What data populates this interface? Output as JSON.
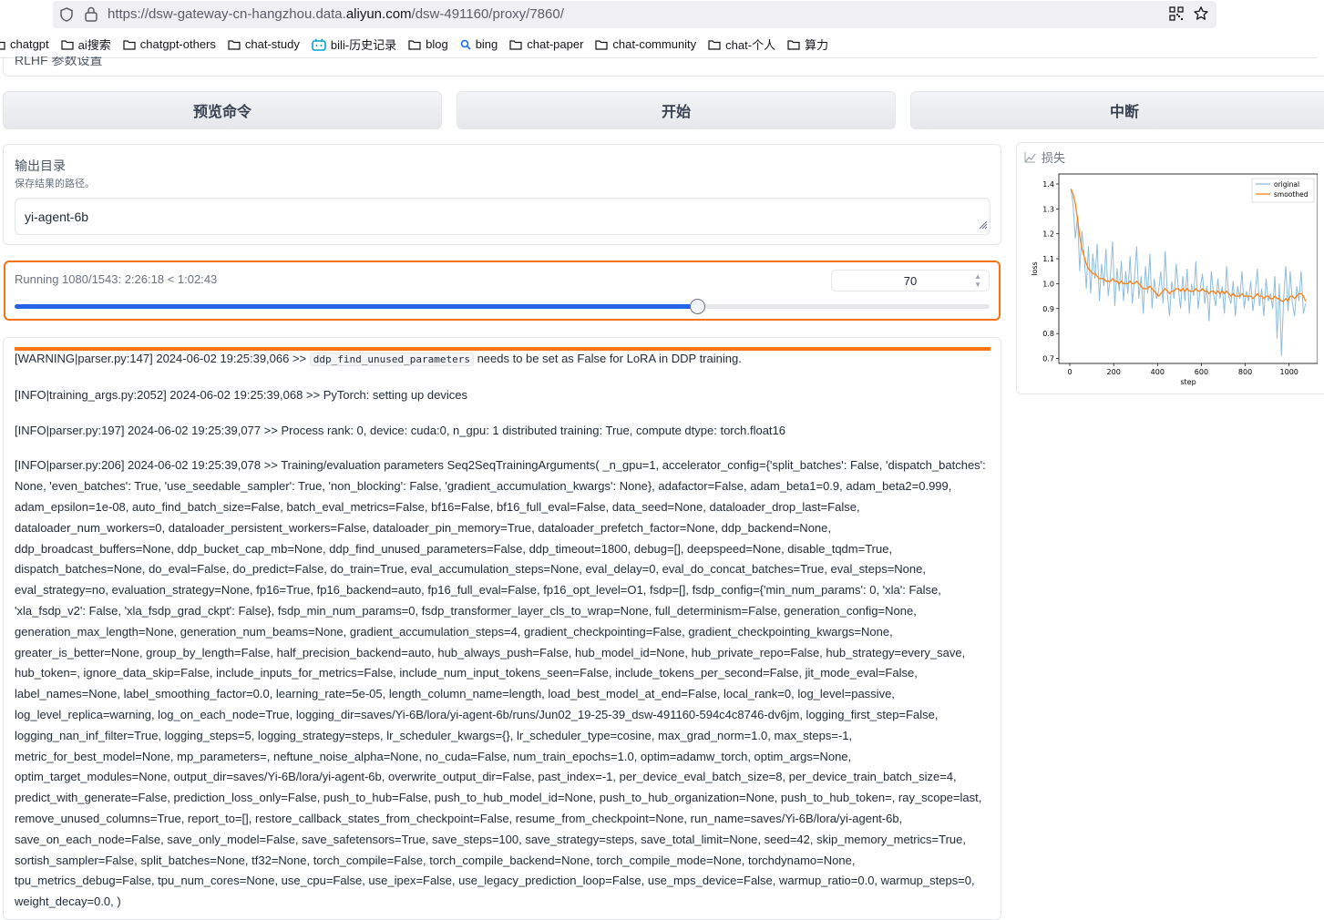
{
  "browser": {
    "url_prefix": "https://dsw-gateway-cn-hangzhou.data.",
    "url_domain": "aliyun.com",
    "url_suffix": "/dsw-491160/proxy/7860/",
    "bookmarks": [
      {
        "label": "chatgpt",
        "icon": "folder-icon"
      },
      {
        "label": "ai搜索",
        "icon": "folder-icon"
      },
      {
        "label": "chatgpt-others",
        "icon": "folder-icon"
      },
      {
        "label": "chat-study",
        "icon": "folder-icon"
      },
      {
        "label": "bili-历史记录",
        "icon": "bilibili-icon"
      },
      {
        "label": "blog",
        "icon": "folder-icon"
      },
      {
        "label": "bing",
        "icon": "search-icon"
      },
      {
        "label": "chat-paper",
        "icon": "folder-icon"
      },
      {
        "label": "chat-community",
        "icon": "folder-icon"
      },
      {
        "label": "chat-个人",
        "icon": "folder-icon"
      },
      {
        "label": "算力",
        "icon": "folder-icon"
      }
    ]
  },
  "app": {
    "rlhf_section_label": "RLHF 参数设置",
    "buttons": {
      "preview": "预览命令",
      "start": "开始",
      "abort": "中断"
    },
    "output_dir": {
      "label": "输出目录",
      "hint": "保存结果的路径。",
      "value": "yi-agent-6b"
    },
    "progress": {
      "label": "Running 1080/1543: 2:26:18 < 1:02:43",
      "number_value": "70",
      "fraction": 0.7
    },
    "log": {
      "line1_before": "[WARNING|parser.py:147] 2024-06-02 19:25:39,066 >> ",
      "line1_code": "ddp_find_unused_parameters",
      "line1_after": " needs to be set as False for LoRA in DDP training.",
      "line2": "[INFO|training_args.py:2052] 2024-06-02 19:25:39,068 >> PyTorch: setting up devices",
      "line3": "[INFO|parser.py:197] 2024-06-02 19:25:39,077 >> Process rank: 0, device: cuda:0, n_gpu: 1 distributed training: True, compute dtype: torch.float16",
      "line4": "[INFO|parser.py:206] 2024-06-02 19:25:39,078 >> Training/evaluation parameters Seq2SeqTrainingArguments( _n_gpu=1, accelerator_config={'split_batches': False, 'dispatch_batches': None, 'even_batches': True, 'use_seedable_sampler': True, 'non_blocking': False, 'gradient_accumulation_kwargs': None}, adafactor=False, adam_beta1=0.9, adam_beta2=0.999, adam_epsilon=1e-08, auto_find_batch_size=False, batch_eval_metrics=False, bf16=False, bf16_full_eval=False, data_seed=None, dataloader_drop_last=False, dataloader_num_workers=0, dataloader_persistent_workers=False, dataloader_pin_memory=True, dataloader_prefetch_factor=None, ddp_backend=None, ddp_broadcast_buffers=None, ddp_bucket_cap_mb=None, ddp_find_unused_parameters=False, ddp_timeout=1800, debug=[], deepspeed=None, disable_tqdm=True, dispatch_batches=None, do_eval=False, do_predict=False, do_train=True, eval_accumulation_steps=None, eval_delay=0, eval_do_concat_batches=True, eval_steps=None, eval_strategy=no, evaluation_strategy=None, fp16=True, fp16_backend=auto, fp16_full_eval=False, fp16_opt_level=O1, fsdp=[], fsdp_config={'min_num_params': 0, 'xla': False, 'xla_fsdp_v2': False, 'xla_fsdp_grad_ckpt': False}, fsdp_min_num_params=0, fsdp_transformer_layer_cls_to_wrap=None, full_determinism=False, generation_config=None, generation_max_length=None, generation_num_beams=None, gradient_accumulation_steps=4, gradient_checkpointing=False, gradient_checkpointing_kwargs=None, greater_is_better=None, group_by_length=False, half_precision_backend=auto, hub_always_push=False, hub_model_id=None, hub_private_repo=False, hub_strategy=every_save, hub_token=, ignore_data_skip=False, include_inputs_for_metrics=False, include_num_input_tokens_seen=False, include_tokens_per_second=False, jit_mode_eval=False, label_names=None, label_smoothing_factor=0.0, learning_rate=5e-05, length_column_name=length, load_best_model_at_end=False, local_rank=0, log_level=passive, log_level_replica=warning, log_on_each_node=True, logging_dir=saves/Yi-6B/lora/yi-agent-6b/runs/Jun02_19-25-39_dsw-491160-594c4c8746-dv6jm, logging_first_step=False, logging_nan_inf_filter=True, logging_steps=5, logging_strategy=steps, lr_scheduler_kwargs={}, lr_scheduler_type=cosine, max_grad_norm=1.0, max_steps=-1, metric_for_best_model=None, mp_parameters=, neftune_noise_alpha=None, no_cuda=False, num_train_epochs=1.0, optim=adamw_torch, optim_args=None, optim_target_modules=None, output_dir=saves/Yi-6B/lora/yi-agent-6b, overwrite_output_dir=False, past_index=-1, per_device_eval_batch_size=8, per_device_train_batch_size=4, predict_with_generate=False, prediction_loss_only=False, push_to_hub=False, push_to_hub_model_id=None, push_to_hub_organization=None, push_to_hub_token=, ray_scope=last, remove_unused_columns=True, report_to=[], restore_callback_states_from_checkpoint=False, resume_from_checkpoint=None, run_name=saves/Yi-6B/lora/yi-agent-6b, save_on_each_node=False, save_only_model=False, save_safetensors=True, save_steps=100, save_strategy=steps, save_total_limit=None, seed=42, skip_memory_metrics=True, sortish_sampler=False, split_batches=None, tf32=None, torch_compile=False, torch_compile_backend=None, torch_compile_mode=None, torchdynamo=None, tpu_metrics_debug=False, tpu_num_cores=None, use_cpu=False, use_ipex=False, use_legacy_prediction_loop=False, use_mps_device=False, warmup_ratio=0.0, warmup_steps=0, weight_decay=0.0, )"
    }
  },
  "chart_data": {
    "type": "line",
    "panel_label": "损失",
    "xlabel": "step",
    "ylabel": "loss",
    "xlim": [
      -50,
      1130
    ],
    "ylim": [
      0.68,
      1.44
    ],
    "xticks": [
      0,
      200,
      400,
      600,
      800,
      1000
    ],
    "yticks": [
      0.7,
      0.8,
      0.9,
      1.0,
      1.1,
      1.2,
      1.3,
      1.4
    ],
    "legend_position": "top-right",
    "colors": {
      "original": "#8fbcdb",
      "smoothed": "#ff7f0e"
    },
    "series": [
      {
        "name": "original",
        "x": [
          5,
          15,
          25,
          35,
          45,
          55,
          65,
          75,
          85,
          95,
          105,
          115,
          125,
          135,
          145,
          155,
          165,
          175,
          185,
          195,
          205,
          215,
          225,
          235,
          245,
          255,
          265,
          275,
          285,
          295,
          305,
          315,
          325,
          335,
          345,
          355,
          365,
          375,
          385,
          395,
          405,
          415,
          425,
          435,
          445,
          455,
          465,
          475,
          485,
          495,
          505,
          515,
          525,
          535,
          545,
          555,
          565,
          575,
          585,
          595,
          605,
          615,
          625,
          635,
          645,
          655,
          665,
          675,
          685,
          695,
          705,
          715,
          725,
          735,
          745,
          755,
          765,
          775,
          785,
          795,
          805,
          815,
          825,
          835,
          845,
          855,
          865,
          875,
          885,
          895,
          905,
          915,
          925,
          935,
          945,
          955,
          965,
          975,
          985,
          995,
          1005,
          1015,
          1025,
          1035,
          1045,
          1055,
          1065,
          1075
        ],
        "values": [
          1.38,
          1.32,
          1.18,
          1.27,
          1.05,
          1.21,
          1.12,
          0.98,
          1.15,
          0.96,
          1.12,
          1.02,
          1.16,
          0.93,
          1.08,
          0.99,
          1.14,
          0.95,
          1.03,
          1.17,
          0.91,
          1.06,
          0.97,
          1.09,
          0.93,
          1.05,
          0.96,
          1.11,
          0.92,
          1.02,
          1.15,
          0.94,
          1.03,
          0.88,
          1.07,
          0.96,
          1.12,
          0.9,
          1.02,
          0.94,
          0.97,
          1.05,
          0.92,
          1.13,
          0.96,
          0.87,
          1.01,
          0.94,
          1.08,
          0.98,
          0.9,
          1.03,
          0.93,
          1.06,
          0.88,
          1.0,
          0.95,
          1.09,
          0.9,
          0.98,
          1.04,
          0.92,
          0.99,
          0.85,
          1.05,
          0.96,
          0.91,
          1.02,
          0.94,
          0.99,
          0.88,
          1.07,
          0.95,
          0.92,
          1.01,
          0.87,
          0.99,
          0.94,
          1.05,
          0.9,
          0.97,
          0.93,
          1.01,
          0.89,
          0.96,
          1.06,
          0.91,
          0.98,
          0.87,
          1.02,
          0.93,
          0.96,
          0.9,
          1.03,
          0.78,
          1.0,
          0.71,
          0.94,
          1.07,
          0.89,
          1.05,
          0.92,
          0.87,
          0.99,
          0.93,
          1.05,
          0.88,
          0.92
        ]
      },
      {
        "name": "smoothed",
        "x": [
          5,
          15,
          25,
          35,
          45,
          55,
          65,
          75,
          85,
          95,
          105,
          115,
          125,
          135,
          145,
          155,
          165,
          175,
          185,
          195,
          205,
          215,
          225,
          235,
          245,
          255,
          265,
          275,
          285,
          295,
          305,
          315,
          325,
          335,
          345,
          355,
          365,
          375,
          385,
          395,
          405,
          415,
          425,
          435,
          445,
          455,
          465,
          475,
          485,
          495,
          505,
          515,
          525,
          535,
          545,
          555,
          565,
          575,
          585,
          595,
          605,
          615,
          625,
          635,
          645,
          655,
          665,
          675,
          685,
          695,
          705,
          715,
          725,
          735,
          745,
          755,
          765,
          775,
          785,
          795,
          805,
          815,
          825,
          835,
          845,
          855,
          865,
          875,
          885,
          895,
          905,
          915,
          925,
          935,
          945,
          955,
          965,
          975,
          985,
          995,
          1005,
          1015,
          1025,
          1035,
          1045,
          1055,
          1065,
          1075
        ],
        "values": [
          1.38,
          1.36,
          1.32,
          1.26,
          1.19,
          1.14,
          1.11,
          1.08,
          1.06,
          1.05,
          1.04,
          1.04,
          1.03,
          1.02,
          1.02,
          1.02,
          1.01,
          1.01,
          1.01,
          1.02,
          1.01,
          1.01,
          1.0,
          1.01,
          1.0,
          1.0,
          1.0,
          1.01,
          1.0,
          1.0,
          1.01,
          1.0,
          0.99,
          0.98,
          0.98,
          0.98,
          0.99,
          0.98,
          0.97,
          0.96,
          0.95,
          0.96,
          0.97,
          0.98,
          0.97,
          0.96,
          0.97,
          0.97,
          0.98,
          0.98,
          0.97,
          0.98,
          0.97,
          0.98,
          0.97,
          0.97,
          0.97,
          0.98,
          0.97,
          0.97,
          0.98,
          0.97,
          0.97,
          0.96,
          0.97,
          0.97,
          0.96,
          0.97,
          0.96,
          0.97,
          0.96,
          0.97,
          0.96,
          0.95,
          0.96,
          0.95,
          0.95,
          0.95,
          0.96,
          0.95,
          0.95,
          0.95,
          0.95,
          0.94,
          0.95,
          0.96,
          0.95,
          0.95,
          0.94,
          0.95,
          0.95,
          0.94,
          0.94,
          0.95,
          0.94,
          0.94,
          0.93,
          0.93,
          0.94,
          0.93,
          0.95,
          0.95,
          0.94,
          0.95,
          0.96,
          0.96,
          0.95,
          0.93
        ]
      }
    ]
  }
}
